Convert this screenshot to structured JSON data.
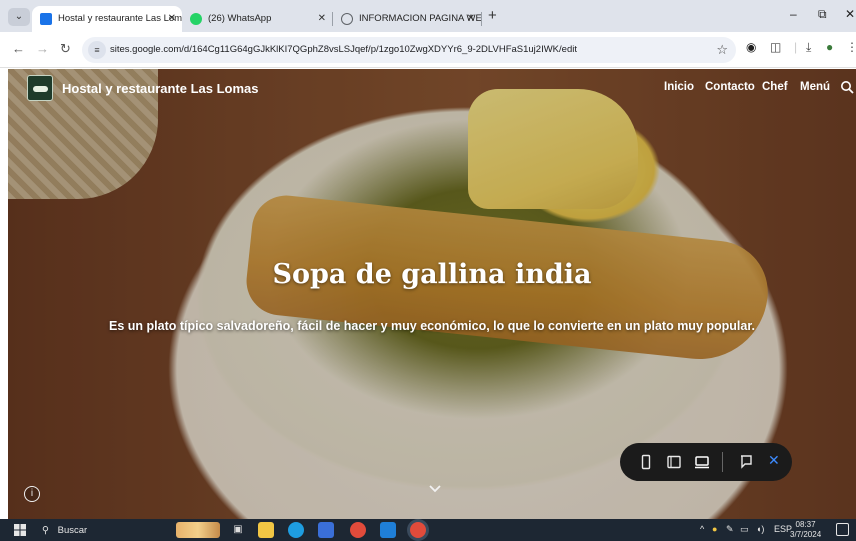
{
  "browser": {
    "tabs": [
      {
        "title": "Hostal y restaurante Las Lomas",
        "active": true,
        "favicon_color": "#1a73e8",
        "close": "✕"
      },
      {
        "title": "(26) WhatsApp",
        "active": false,
        "favicon_color": "#25d366",
        "close": "✕"
      },
      {
        "title": "INFORMACION PAGINA WEB (",
        "active": false,
        "favicon_color": "#5f6368",
        "close": "✕"
      }
    ],
    "new_tab": "+",
    "window_controls": {
      "minimize": "–",
      "restore": "⧉",
      "close": "✕"
    },
    "address": "sites.google.com/d/164Cg11G64gGJkKlKI7QGphZ8vsLSJqef/p/1zgo10ZwgXDYYr6_9-2DLVHFaS1uj2IWK/edit"
  },
  "site": {
    "name": "Hostal y restaurante Las Lomas",
    "nav": [
      {
        "label": "Inicio",
        "active": true
      },
      {
        "label": "Contacto",
        "active": false
      },
      {
        "label": "Chef",
        "active": false
      },
      {
        "label": "Menú",
        "active": false
      }
    ],
    "hero_title": "Sopa de gallina india",
    "hero_subtitle": "Es un plato típico salvadoreño, fácil de hacer y muy económico, lo que lo convierte en un plato muy popular.",
    "info_label": "i",
    "preview_close": "✕"
  },
  "taskbar": {
    "search_placeholder": "Buscar",
    "tray_lang": "ESP",
    "time": "08:37",
    "date": "3/7/2024"
  },
  "colors": {
    "chrome_bg": "#dfe3eb",
    "preview_bar": "#1b1b1b",
    "taskbar": "#1d2733",
    "close_accent": "#3d8bff"
  }
}
